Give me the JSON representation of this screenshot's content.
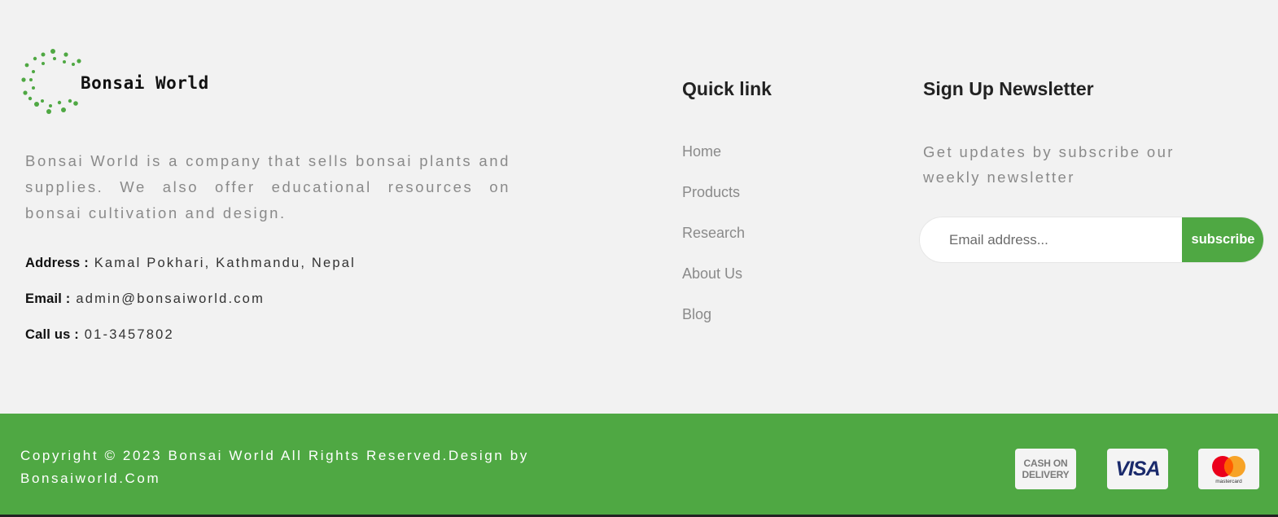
{
  "brand": {
    "name": "Bonsai World",
    "accent_color": "#4fa843"
  },
  "about": {
    "text": "Bonsai World is a company that sells bonsai plants and supplies. We also offer educational resources on bonsai cultivation and design."
  },
  "contact": {
    "address_label": "Address :",
    "address_value": "Kamal Pokhari, Kathmandu, Nepal",
    "email_label": "Email :",
    "email_value": "admin@bonsaiworld.com",
    "phone_label": "Call us :",
    "phone_value": "01-3457802"
  },
  "quick_links": {
    "title": "Quick link",
    "items": [
      {
        "label": "Home"
      },
      {
        "label": "Products"
      },
      {
        "label": "Research"
      },
      {
        "label": "About Us"
      },
      {
        "label": "Blog"
      }
    ]
  },
  "newsletter": {
    "title": "Sign Up Newsletter",
    "text": "Get updates by subscribe our weekly newsletter",
    "input_placeholder": "Email address...",
    "button_label": "subscribe"
  },
  "footer_bottom": {
    "copyright": "Copyright © 2023 Bonsai World All Rights Reserved.Design by Bonsaiworld.Com",
    "payments": {
      "cod_line1": "CASH ON",
      "cod_line2": "DELIVERY",
      "visa": "VISA",
      "mastercard": "mastercard"
    }
  }
}
